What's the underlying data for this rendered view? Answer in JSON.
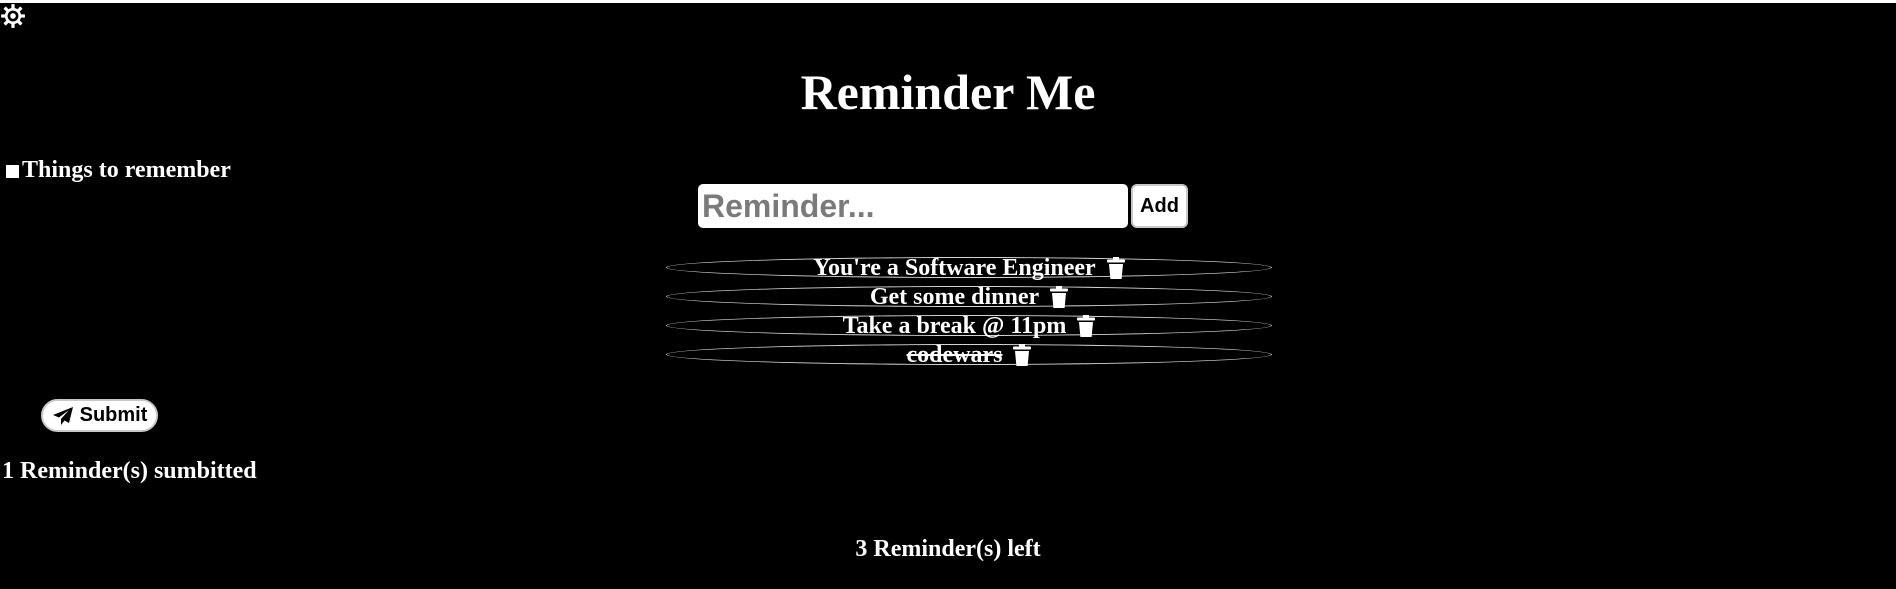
{
  "app": {
    "title": "Reminder Me"
  },
  "theme": {
    "background": "#000000",
    "text": "#ffffff",
    "icon": "gear-icon"
  },
  "sidebar": {
    "label": "Things to remember"
  },
  "form": {
    "placeholder": "Reminder...",
    "value": "",
    "add_label": "Add"
  },
  "reminders": [
    {
      "text": "You're a Software Engineer",
      "done": false,
      "icon": "trash-icon"
    },
    {
      "text": "Get some dinner",
      "done": false,
      "icon": "trash-icon"
    },
    {
      "text": "Take a break @ 11pm",
      "done": false,
      "icon": "trash-icon"
    },
    {
      "text": "codewars",
      "done": true,
      "icon": "trash-icon"
    }
  ],
  "submit": {
    "label": "Submit",
    "icon": "paper-plane-icon"
  },
  "status": {
    "submitted": "1 Reminder(s) sumbitted",
    "left": "3 Reminder(s) left"
  }
}
